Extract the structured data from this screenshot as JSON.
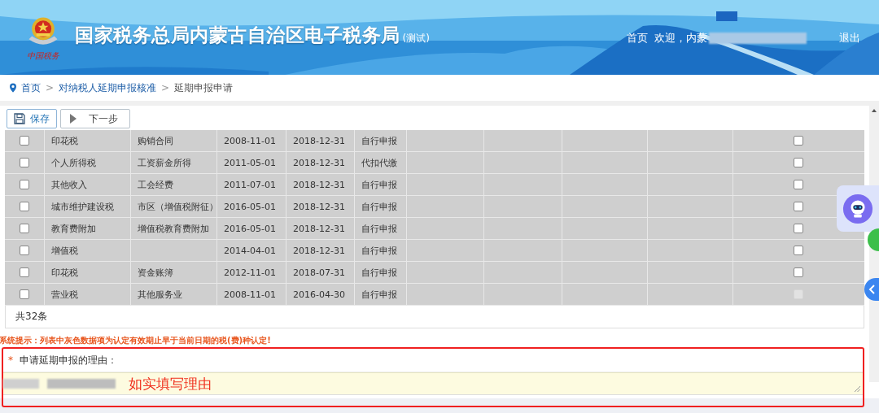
{
  "header": {
    "title": "国家税务总局内蒙古自治区电子税务局",
    "title_suffix": "(测试)",
    "logo_caption": "中国税务",
    "nav_home": "首页",
    "welcome": "欢迎，内蒙",
    "logout": "退出"
  },
  "breadcrumb_separator": ">",
  "breadcrumb": [
    {
      "label": "首页",
      "kind": "home"
    },
    {
      "label": "对纳税人延期申报核准",
      "kind": "link"
    },
    {
      "label": "延期申报申请",
      "kind": "current"
    }
  ],
  "toolbar": [
    {
      "label": "保存",
      "kind": "save"
    },
    {
      "label": "下一步",
      "kind": "next"
    }
  ],
  "table": {
    "rows": [
      {
        "checked": false,
        "cells": [
          "印花税",
          "购销合同",
          "2008-11-01",
          "2018-12-31",
          "自行申报"
        ],
        "end_checked": false,
        "end_disabled": false
      },
      {
        "checked": false,
        "cells": [
          "个人所得税",
          "工资薪金所得",
          "2011-05-01",
          "2018-12-31",
          "代扣代缴"
        ],
        "end_checked": false,
        "end_disabled": false
      },
      {
        "checked": false,
        "cells": [
          "其他收入",
          "工会经费",
          "2011-07-01",
          "2018-12-31",
          "自行申报"
        ],
        "end_checked": false,
        "end_disabled": false
      },
      {
        "checked": false,
        "cells": [
          "城市维护建设税",
          "市区（增值税附征）",
          "2016-05-01",
          "2018-12-31",
          "自行申报"
        ],
        "end_checked": false,
        "end_disabled": false
      },
      {
        "checked": false,
        "cells": [
          "教育费附加",
          "增值税教育费附加",
          "2016-05-01",
          "2018-12-31",
          "自行申报"
        ],
        "end_checked": false,
        "end_disabled": false
      },
      {
        "checked": false,
        "cells": [
          "增值税",
          "",
          "2014-04-01",
          "2018-12-31",
          "自行申报"
        ],
        "end_checked": false,
        "end_disabled": false
      },
      {
        "checked": false,
        "cells": [
          "印花税",
          "资金账簿",
          "2012-11-01",
          "2018-07-31",
          "自行申报"
        ],
        "end_checked": false,
        "end_disabled": false
      },
      {
        "checked": false,
        "cells": [
          "营业税",
          "其他服务业",
          "2008-11-01",
          "2016-04-30",
          "自行申报"
        ],
        "end_checked": false,
        "end_disabled": true
      }
    ],
    "total": "共32条"
  },
  "hint": "系统提示：列表中灰色数据项为认定有效期止早于当前日期的税(费)种认定!",
  "reason": {
    "label": "申请延期申报的理由：",
    "required_mark": "*",
    "annotation": "如实填写理由"
  }
}
